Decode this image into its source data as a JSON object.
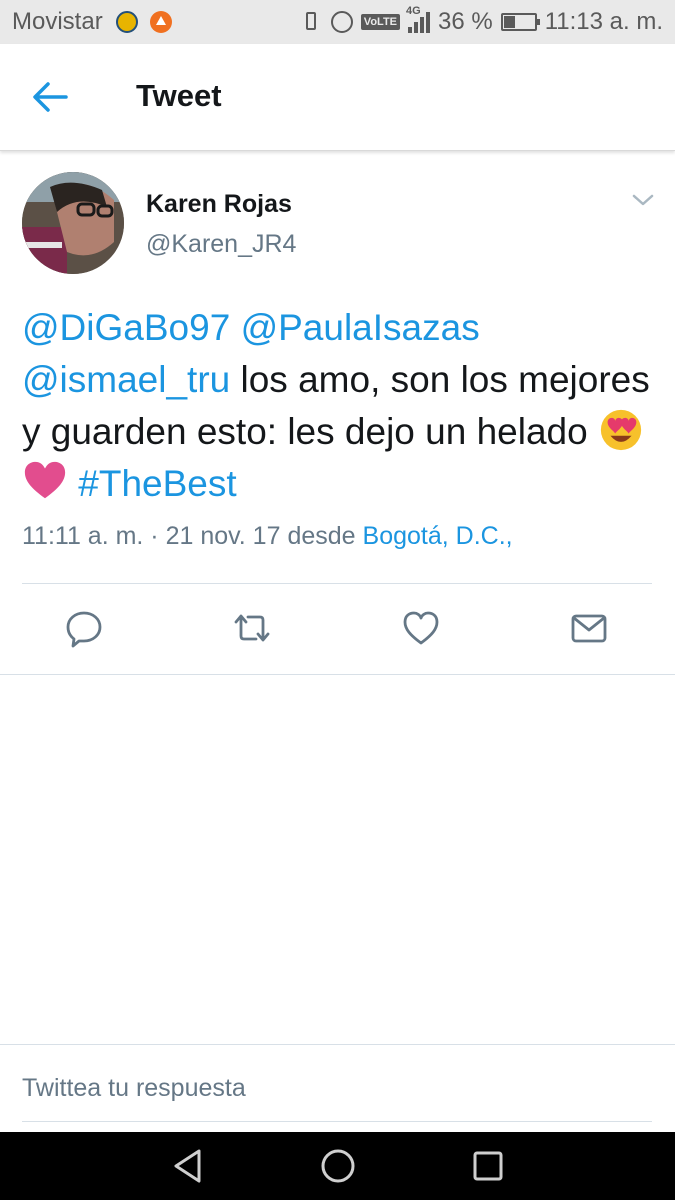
{
  "status_bar": {
    "carrier": "Movistar",
    "volte": "VoLTE",
    "network": "4G",
    "battery": "36 %",
    "battery_level": 0.36,
    "time": "11:13 a. m.",
    "icons": [
      "app-icon-league",
      "app-icon-arrow",
      "vibrate-icon",
      "alarm-icon",
      "signal-icon",
      "battery-icon"
    ]
  },
  "header": {
    "title": "Tweet",
    "back_icon": "back-arrow-icon"
  },
  "tweet": {
    "author_name": "Karen Rojas",
    "author_handle": "@Karen_JR4",
    "mention_1": "@DiGaBo97",
    "mention_2": "@PaulaIsazas",
    "mention_3": "@ismael_tru",
    "body_text": " los amo, son los mejores y guarden esto: les dejo un helado ",
    "emoji_1": "smiling-face-with-heart-eyes",
    "emoji_2": "heavy-heart",
    "hashtag": "#TheBest",
    "timestamp": "11:11 a. m. · 21 nov. 17",
    "from_label": "desde",
    "place": "Bogotá, D.C.,"
  },
  "actions": [
    "reply-icon",
    "retweet-icon",
    "like-icon",
    "message-icon"
  ],
  "reply_box": {
    "placeholder": "Twittea tu respuesta"
  },
  "nav_bar": [
    "back-triangle-icon",
    "home-circle-icon",
    "recents-square-icon"
  ],
  "colors": {
    "accent": "#1b95e0",
    "text": "#14171a",
    "muted": "#657786",
    "status_bar_bg": "#e9e9e9",
    "nav_bar_bg": "#000000"
  }
}
